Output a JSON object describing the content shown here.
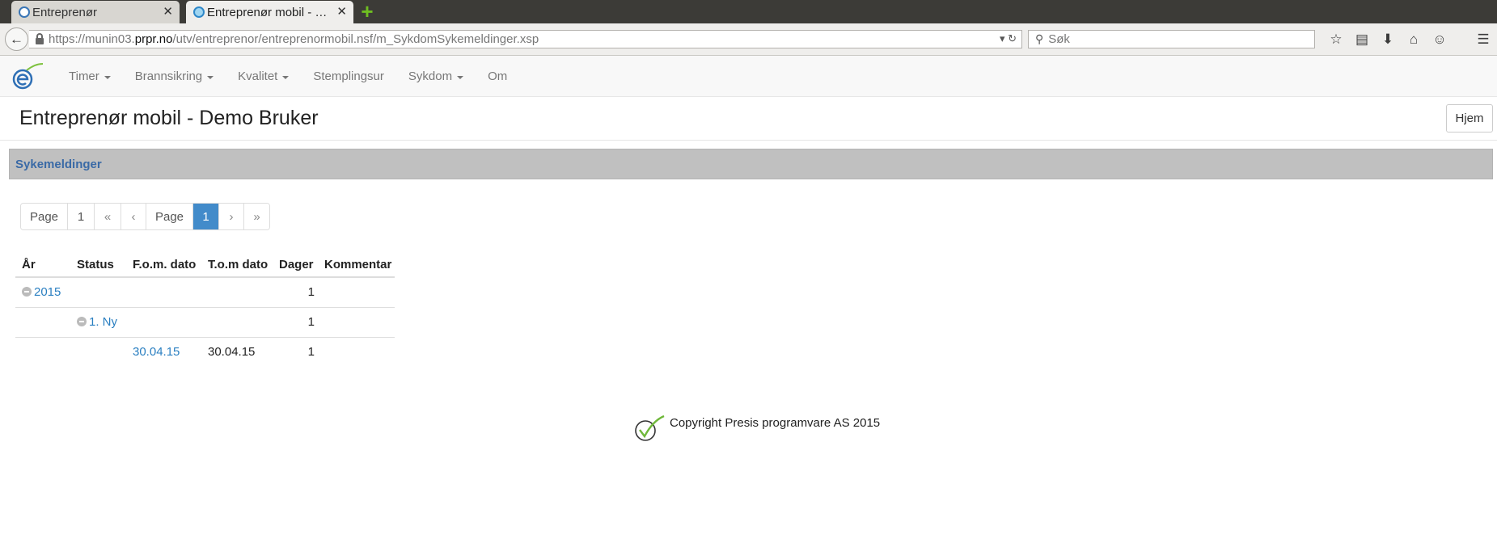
{
  "browser": {
    "tabs": [
      {
        "title": "Entreprenør",
        "active": false
      },
      {
        "title": "Entreprenør mobil - …",
        "active": true
      }
    ],
    "url": {
      "prefix": "https://munin03.",
      "host": "prpr.no",
      "path": "/utv/entreprenor/entreprenormobil.nsf/m_SykdomSykemeldinger.xsp"
    },
    "search_placeholder": "Søk"
  },
  "nav": {
    "menu": [
      {
        "label": "Timer",
        "dropdown": true
      },
      {
        "label": "Brannsikring",
        "dropdown": true
      },
      {
        "label": "Kvalitet",
        "dropdown": true
      },
      {
        "label": "Stemplingsur",
        "dropdown": false
      },
      {
        "label": "Sykdom",
        "dropdown": true
      },
      {
        "label": "Om",
        "dropdown": false
      }
    ]
  },
  "page": {
    "title": "Entreprenør mobil - Demo Bruker",
    "home_label": "Hjem",
    "section_title": "Sykemeldinger"
  },
  "pager": {
    "items": [
      "Page",
      "1",
      "«",
      "‹",
      "Page",
      "1",
      "›",
      "»"
    ]
  },
  "table": {
    "headers": [
      "År",
      "Status",
      "F.o.m. dato",
      "T.o.m dato",
      "Dager",
      "Kommentar"
    ],
    "rows": [
      {
        "year": "2015",
        "status": "",
        "from": "",
        "to": "",
        "days": "1",
        "comment": ""
      },
      {
        "year": "",
        "status": "1. Ny",
        "from": "",
        "to": "",
        "days": "1",
        "comment": ""
      },
      {
        "year": "",
        "status": "",
        "from": "30.04.15",
        "to": "30.04.15",
        "days": "1",
        "comment": ""
      }
    ]
  },
  "footer": {
    "copyright": "Copyright Presis programvare AS 2015"
  },
  "colors": {
    "accent": "#428bca",
    "link": "#2a7fc1",
    "section_title": "#3a6aa6",
    "section_bg": "#c0c0c0"
  }
}
